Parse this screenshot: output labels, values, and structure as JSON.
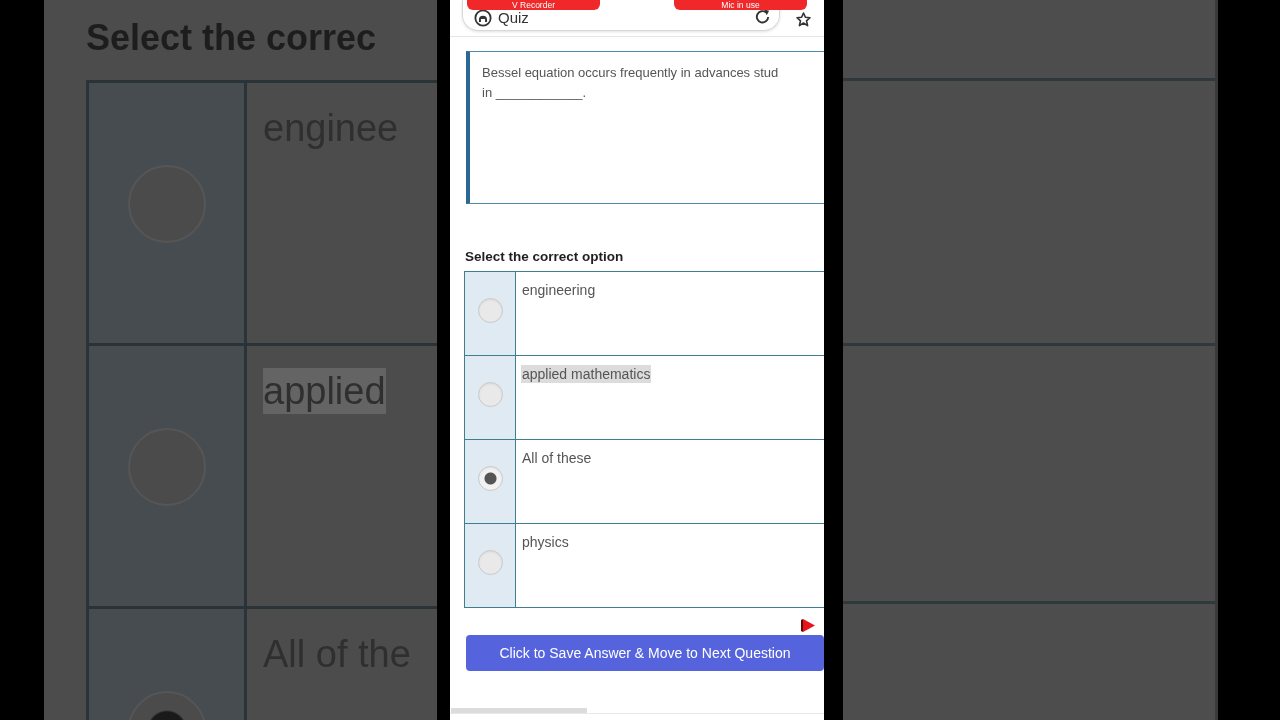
{
  "backdrop": {
    "heading": "Select the correc",
    "options": [
      {
        "label": "enginee",
        "selected": false,
        "highlighted": false
      },
      {
        "label": "applied",
        "selected": false,
        "highlighted": true
      },
      {
        "label": "All of the",
        "selected": true,
        "highlighted": false
      }
    ]
  },
  "recorder_pills": [
    {
      "label": "V Recorder"
    },
    {
      "label": "Mic in use"
    }
  ],
  "top_bar": {
    "title": "Quiz"
  },
  "question": {
    "text": "Bessel equation occurs frequently in advances stud\nin ____________."
  },
  "prompt": "Select the correct option",
  "options": [
    {
      "label": "engineering",
      "selected": false,
      "highlighted": false
    },
    {
      "label": "applied mathematics",
      "selected": false,
      "highlighted": true
    },
    {
      "label": "All of these",
      "selected": true,
      "highlighted": false
    },
    {
      "label": "physics",
      "selected": false,
      "highlighted": false
    }
  ],
  "save_button": {
    "label": "Click to Save Answer & Move to Next Question"
  }
}
